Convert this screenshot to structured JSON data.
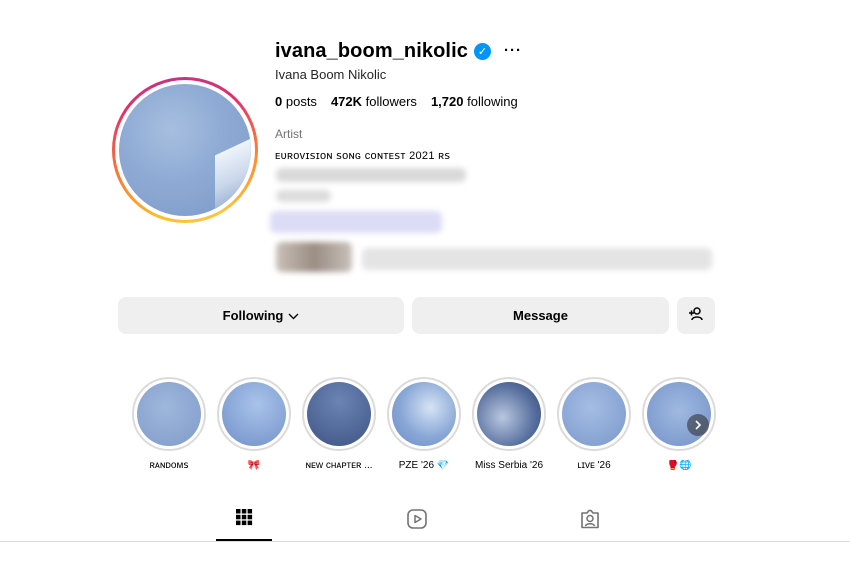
{
  "profile": {
    "username": "ivana_boom_nikolic",
    "full_name": "Ivana Boom Nikolic",
    "posts_count": "0",
    "posts_label": "posts",
    "followers_count": "472K",
    "followers_label": "followers",
    "following_count": "1,720",
    "following_label": "following",
    "category": "Artist",
    "bio_line": "ᴇᴜʀᴏᴠɪꜱɪᴏɴ ꜱᴏɴɢ ᴄᴏɴᴛᴇꜱᴛ 2021 ʀꜱ"
  },
  "actions": {
    "following_label": "Following",
    "message_label": "Message"
  },
  "highlights": [
    {
      "label": "ʀᴀɴᴅᴏᴍꜱ"
    },
    {
      "label": "🎀"
    },
    {
      "label": "ɴᴇᴡ ᴄʜᴀᴘᴛᴇʀ ..."
    },
    {
      "label": "PZE '26 💎"
    },
    {
      "label": "Miss Serbia '26"
    },
    {
      "label": "ʟɪᴠᴇ '26"
    },
    {
      "label": "🥊🌐"
    }
  ],
  "icons": {
    "verified": "verified-badge-icon",
    "more": "more-options-icon",
    "chevron": "chevron-down-icon",
    "add_user": "add-user-icon",
    "next": "chevron-right-icon",
    "grid": "grid-icon",
    "reels": "reels-icon",
    "tagged": "tagged-icon"
  },
  "colors": {
    "verified_blue": "#0095f6",
    "button_bg": "#efefef",
    "muted_text": "#737373"
  }
}
